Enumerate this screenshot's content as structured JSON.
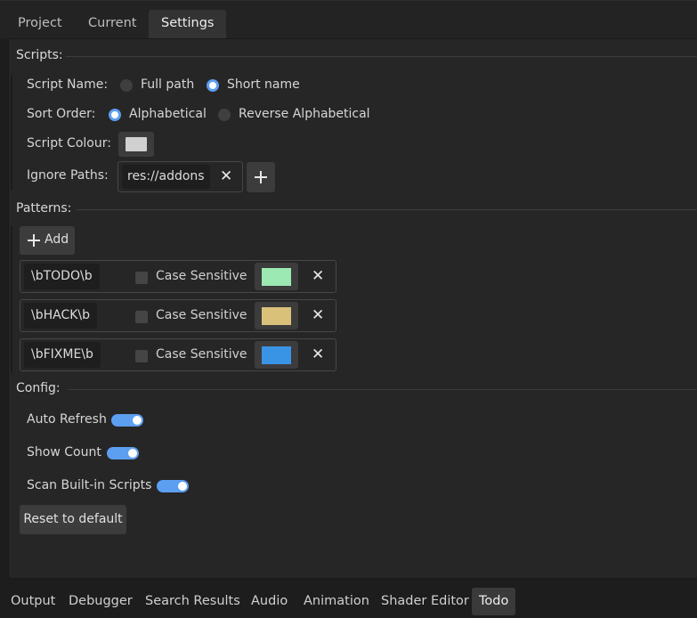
{
  "tabs": [
    "Project",
    "Current",
    "Settings"
  ],
  "active_tab": "Settings",
  "scripts": {
    "section_label": "Scripts:",
    "script_name": {
      "label": "Script Name:",
      "options": [
        "Full path",
        "Short name"
      ],
      "selected": "Short name"
    },
    "sort_order": {
      "label": "Sort Order:",
      "options": [
        "Alphabetical",
        "Reverse Alphabetical"
      ],
      "selected": "Alphabetical"
    },
    "script_colour": {
      "label": "Script Colour:",
      "color": "#d0d0d0"
    },
    "ignore_paths": {
      "label": "Ignore Paths:",
      "items": [
        "res://addons"
      ]
    }
  },
  "patterns": {
    "section_label": "Patterns:",
    "add_label": "Add",
    "items": [
      {
        "pattern": "\\bTODO\\b",
        "case_label": "Case Sensitive",
        "case_sensitive": false,
        "color": "#9de9b3"
      },
      {
        "pattern": "\\bHACK\\b",
        "case_label": "Case Sensitive",
        "case_sensitive": false,
        "color": "#d9c17a"
      },
      {
        "pattern": "\\bFIXME\\b",
        "case_label": "Case Sensitive",
        "case_sensitive": false,
        "color": "#3a94e6"
      }
    ]
  },
  "config": {
    "section_label": "Config:",
    "auto_refresh": {
      "label": "Auto Refresh",
      "on": true
    },
    "show_count": {
      "label": "Show Count",
      "on": true
    },
    "scan_builtin": {
      "label": "Scan Built-in Scripts",
      "on": true
    },
    "reset_label": "Reset to default"
  },
  "bottom_tabs": [
    "Output",
    "Debugger",
    "Search Results",
    "Audio",
    "Animation",
    "Shader Editor",
    "Todo"
  ],
  "active_bottom_tab": "Todo",
  "colors": {
    "accent": "#5c9ef0",
    "background": "#1d1d1d",
    "panel": "#262626"
  }
}
